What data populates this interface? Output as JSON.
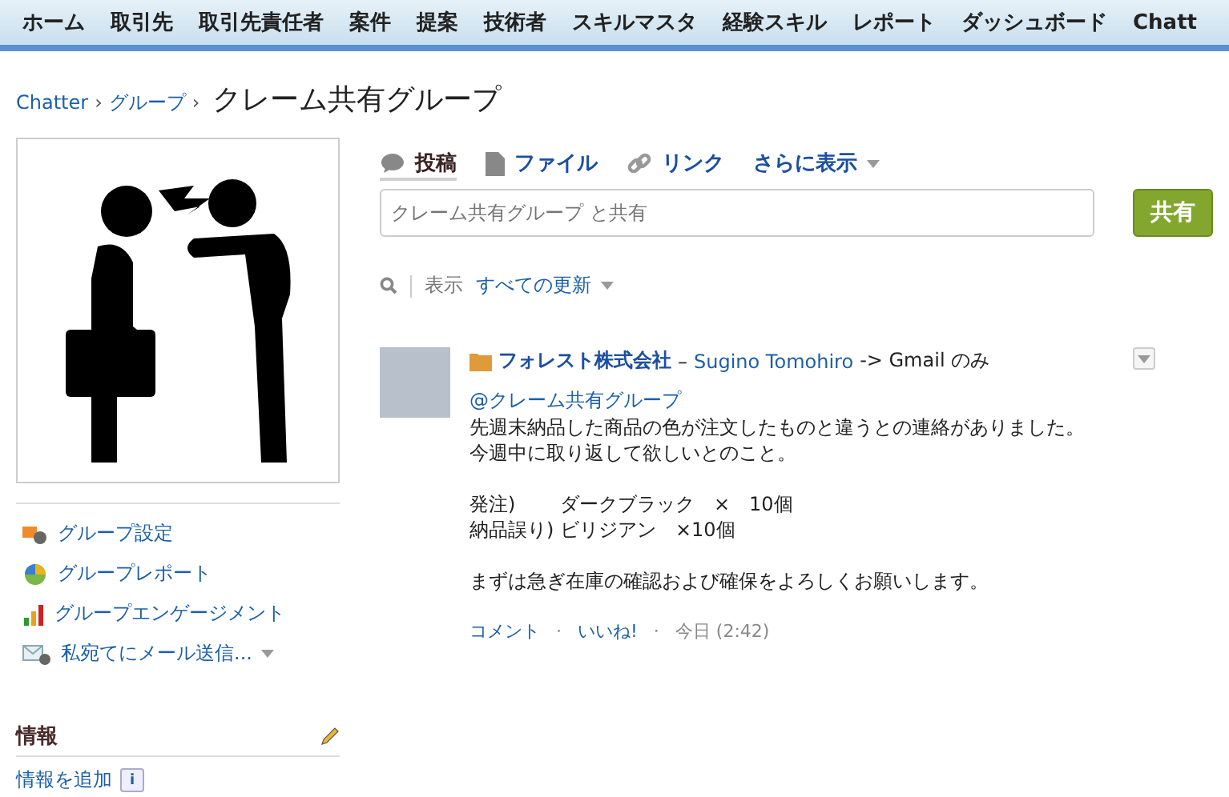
{
  "nav": {
    "items": [
      "ホーム",
      "取引先",
      "取引先責任者",
      "案件",
      "提案",
      "技術者",
      "スキルマスタ",
      "経験スキル",
      "レポート",
      "ダッシュボード",
      "Chatt"
    ]
  },
  "breadcrumb": {
    "links": [
      "Chatter",
      "グループ"
    ],
    "separator": "›",
    "title": "クレーム共有グループ"
  },
  "sidebar": {
    "actions": [
      {
        "kind": "settings",
        "label": "グループ設定",
        "dropdown": false
      },
      {
        "kind": "report",
        "label": "グループレポート",
        "dropdown": false
      },
      {
        "kind": "engagement",
        "label": "グループエンゲージメント",
        "dropdown": false
      },
      {
        "kind": "mail",
        "label": "私宛てにメール送信...",
        "dropdown": true
      }
    ],
    "info": {
      "heading": "情報",
      "add_link": "情報を追加",
      "info_badge": "i"
    }
  },
  "publisher": {
    "tabs": [
      {
        "kind": "post",
        "label": "投稿",
        "selected": true
      },
      {
        "kind": "file",
        "label": "ファイル",
        "selected": false
      },
      {
        "kind": "link",
        "label": "リンク",
        "selected": false
      },
      {
        "kind": "more",
        "label": "さらに表示",
        "selected": false
      }
    ],
    "placeholder": "クレーム共有グループ と共有",
    "share_button": "共有"
  },
  "filter": {
    "label": "表示",
    "value": "すべての更新"
  },
  "feed": [
    {
      "company": "フォレスト株式会社",
      "dash": "–",
      "author": "Sugino Tomohiro",
      "visibility": "-> Gmail のみ",
      "mention": "@クレーム共有グループ",
      "paragraphs": [
        [
          "先週末納品した商品の色が注文したものと違うとの連絡がありました。",
          "今週中に取り返して欲しいとのこと。"
        ],
        [
          "発注)　　 ダークブラック　×　10個",
          "納品誤り) ビリジアン　×10個"
        ],
        [
          "まずは急ぎ在庫の確認および確保をよろしくお願いします。"
        ]
      ],
      "actions": [
        "コメント",
        "いいね!"
      ],
      "dot": "·",
      "time": "今日 (2:42)"
    }
  ]
}
